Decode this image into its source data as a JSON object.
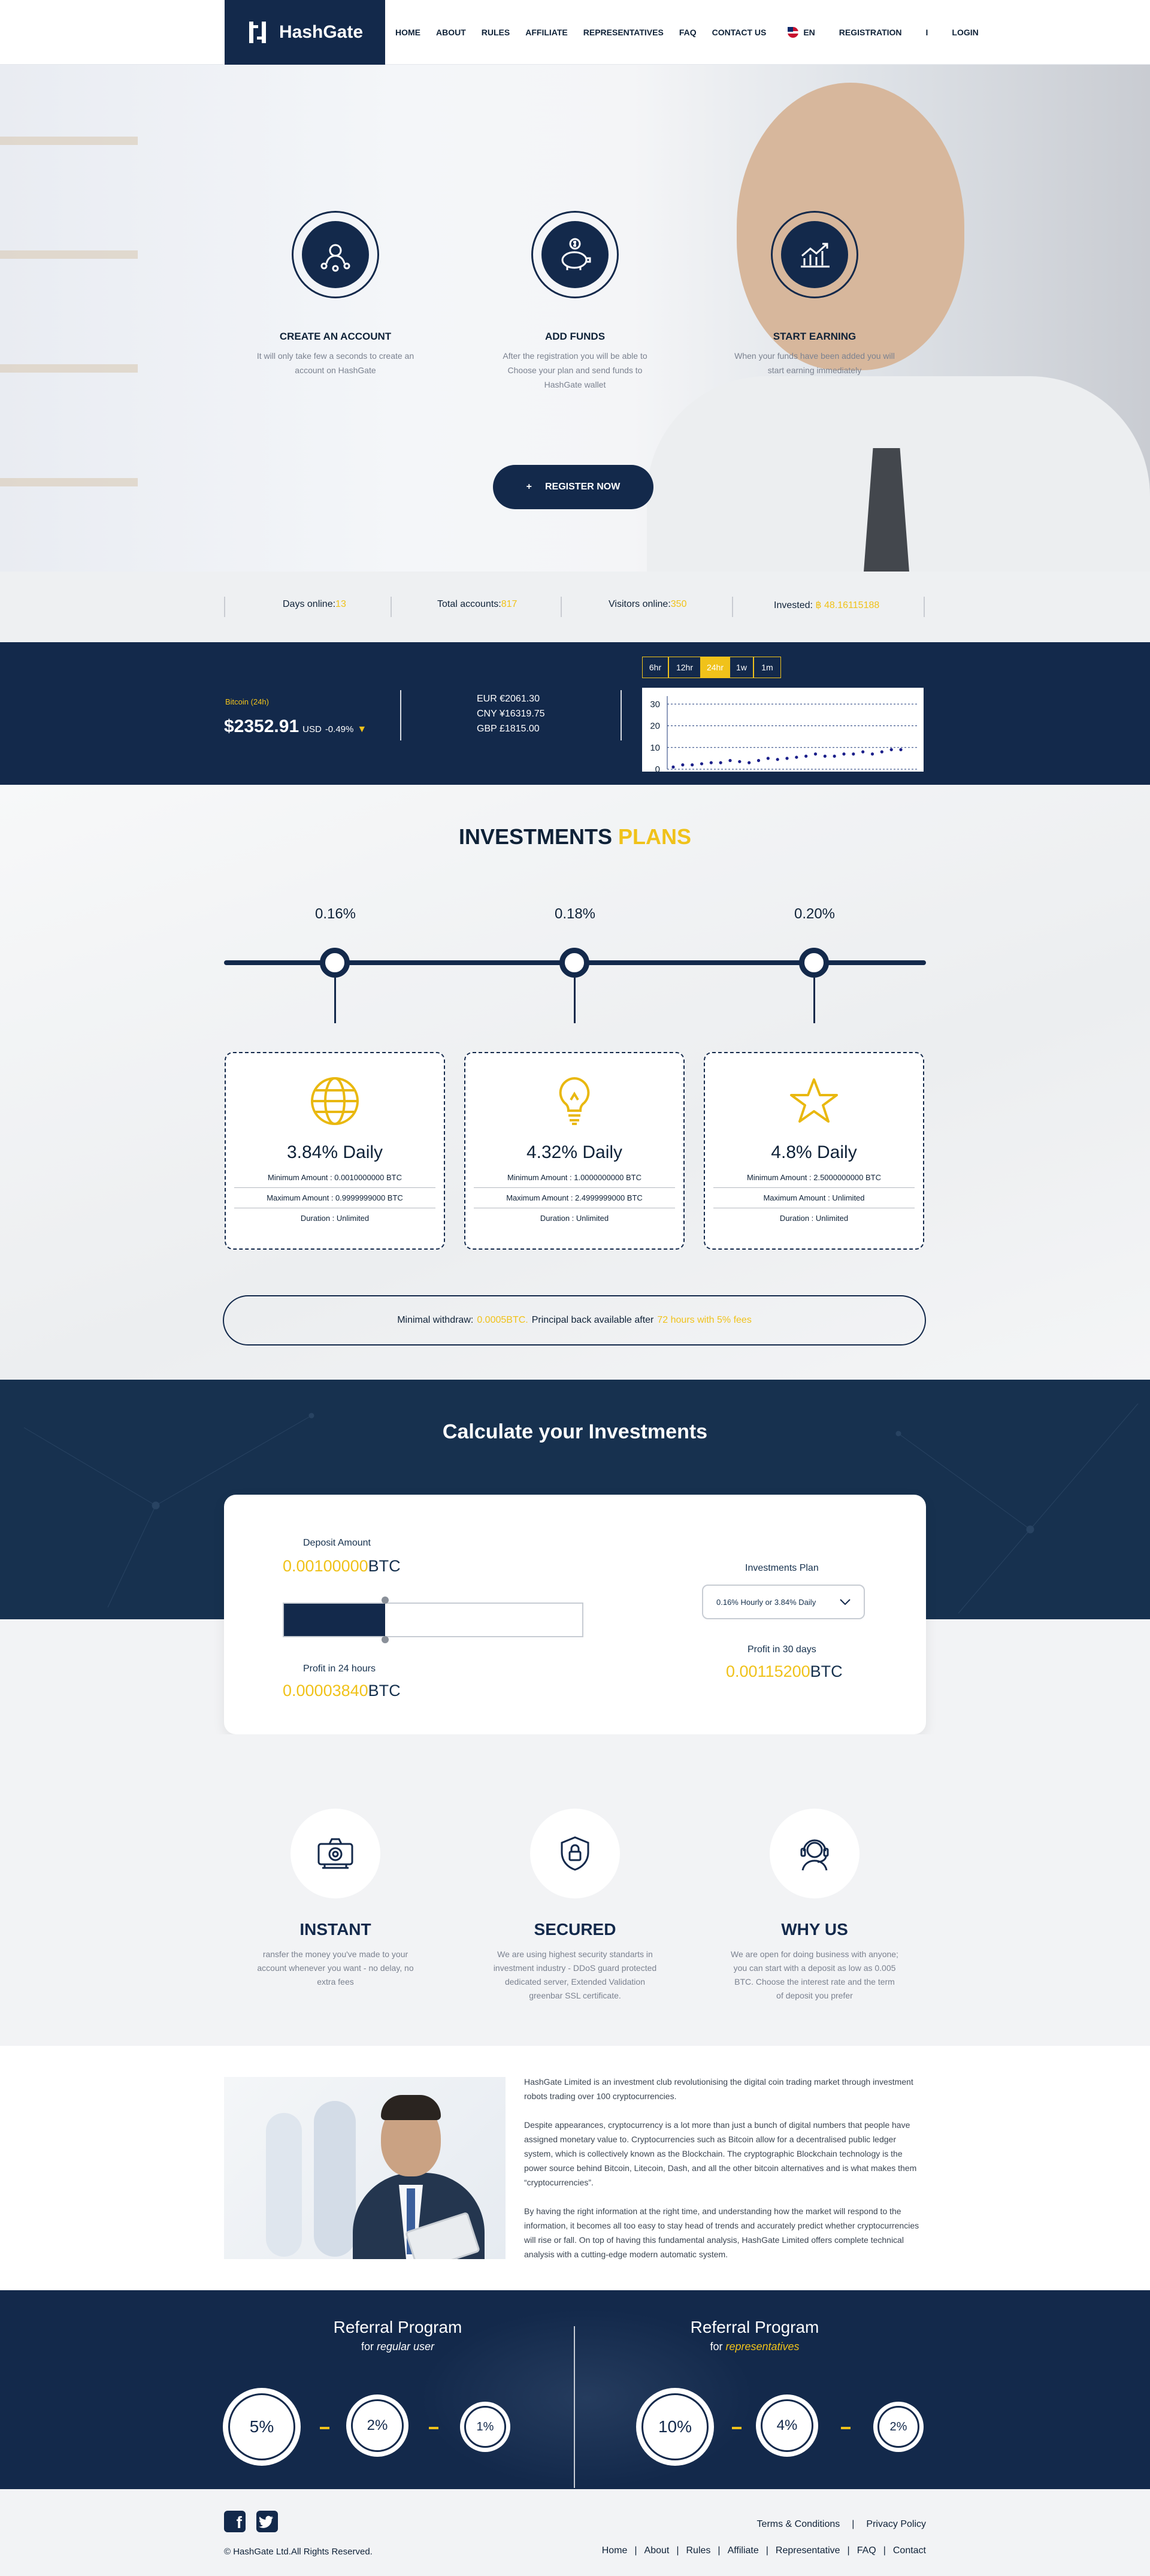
{
  "header": {
    "logo_text": "HashGate",
    "nav": [
      "HOME",
      "ABOUT",
      "RULES",
      "AFFILIATE",
      "REPRESENTATIVES",
      "FAQ",
      "CONTACT US"
    ],
    "language": "EN",
    "registration": "REGISTRATION",
    "separator": "I",
    "login": "LOGIN"
  },
  "hero": {
    "steps": [
      {
        "icon": "user-network-icon",
        "title": "CREATE AN ACCOUNT",
        "text": "It will only take few a seconds to create an account on HashGate"
      },
      {
        "icon": "piggy-bank-icon",
        "title": "ADD FUNDS",
        "text": "After the registration you will be able to Choose your plan and send funds to HashGate wallet"
      },
      {
        "icon": "growth-chart-icon",
        "title": "START EARNING",
        "text": "When your funds have been added you will start earning immediately"
      }
    ],
    "register_plus": "+",
    "register_label": "REGISTER NOW"
  },
  "stats": {
    "days_label": "Days online:",
    "days_value": "13",
    "accounts_label": "Total accounts:",
    "accounts_value": "817",
    "visitors_label": "Visitors online:",
    "visitors_value": "350",
    "invested_label": "Invested:",
    "invested_value": "฿ 48.16115188"
  },
  "bitcoin": {
    "label": "Bitcoin (24h)",
    "price": "$2352.91",
    "currency": "USD",
    "change": "-0.49%",
    "rates": [
      "EUR €2061.30",
      "CNY ¥16319.75",
      "GBP £1815.00"
    ],
    "periods": [
      "6hr",
      "12hr",
      "24hr",
      "1w",
      "1m"
    ],
    "active_period": "24hr",
    "colors": {
      "accent": "#f0c21a",
      "navy": "#13294b"
    }
  },
  "chart_data": {
    "type": "scatter",
    "title": "",
    "xlabel": "",
    "ylabel": "",
    "ylim": [
      0,
      32
    ],
    "yticks": [
      "30",
      "20",
      "10",
      "0"
    ],
    "x": [
      1,
      2,
      3,
      4,
      5,
      6,
      7,
      8,
      9,
      10,
      11,
      12,
      13,
      14,
      15,
      16,
      17,
      18,
      19,
      20,
      21,
      22,
      23,
      24,
      25
    ],
    "values": [
      1,
      2,
      2,
      2.5,
      3,
      3,
      4,
      3.5,
      3,
      4,
      5,
      4.5,
      5,
      5.5,
      6,
      7,
      6,
      6,
      7,
      7,
      8,
      7,
      8,
      9,
      9
    ]
  },
  "plans": {
    "title_main": "INVESTMENTS",
    "title_accent": "PLANS",
    "rates": [
      "0.16%",
      "0.18%",
      "0.20%"
    ],
    "cards": [
      {
        "icon": "globe-icon",
        "daily": "3.84% Daily",
        "min": "Minimum Amount : 0.0010000000 BTC",
        "max": "Maximum Amount : 0.9999999000 BTC",
        "duration": "Duration : Unlimited"
      },
      {
        "icon": "lightbulb-icon",
        "daily": "4.32% Daily",
        "min": "Minimum Amount : 1.0000000000 BTC",
        "max": "Maximum Amount : 2.4999999000 BTC",
        "duration": "Duration : Unlimited"
      },
      {
        "icon": "star-icon",
        "daily": "4.8% Daily",
        "min": "Minimum Amount : 2.5000000000 BTC",
        "max": "Maximum Amount : Unlimited",
        "duration": "Duration : Unlimited"
      }
    ],
    "withdraw_label": "Minimal withdraw:",
    "withdraw_value": "0.0005BTC.",
    "principal_label": "Principal back available after",
    "principal_value": "72 hours with 5% fees"
  },
  "calculator": {
    "title": "Calculate your Investments",
    "deposit_label": "Deposit Amount",
    "deposit_value": "0.00100000",
    "deposit_unit": "BTC",
    "slider_level": 0.34,
    "profit24_label": "Profit in 24 hours",
    "profit24_value": "0.00003840",
    "profit24_unit": "BTC",
    "plan_label": "Investments Plan",
    "plan_selected": "0.16% Hourly or 3.84% Daily",
    "profit30_label": "Profit in 30 days",
    "profit30_value": "0.00115200",
    "profit30_unit": "BTC"
  },
  "features": [
    {
      "icon": "camera-icon",
      "title": "INSTANT",
      "text": "ransfer the money you've made to your account whenever you want - no delay, no extra fees"
    },
    {
      "icon": "shield-lock-icon",
      "title": "SECURED",
      "text": "We are using highest security standarts in investment industry - DDoS guard protected dedicated server, Extended Validation greenbar SSL certificate."
    },
    {
      "icon": "headset-icon",
      "title": "WHY US",
      "text": "We are open for doing business with anyone; you can start with a deposit as low as 0.005 BTC. Choose the interest rate and the term of deposit you prefer"
    }
  ],
  "about": {
    "paragraphs": [
      "HashGate Limited is an investment club revolutionising the digital coin trading market through investment robots trading over 100 cryptocurrencies.",
      "Despite appearances, cryptocurrency is a lot more than just a bunch of digital numbers that people have assigned monetary value to. Cryptocurrencies such as Bitcoin allow for a decentralised public ledger system, which is collectively known as the Blockchain. The cryptographic Blockchain technology is the power source behind Bitcoin, Litecoin, Dash, and all the other bitcoin alternatives and is what makes them “cryptocurrencies”.",
      "By having the right information at the right time, and understanding how the market will respond to the information, it becomes all too easy to stay head of trends and accurately predict whether cryptocurrencies will rise or fall. On top of having this fundamental analysis, HashGate Limited offers complete technical analysis with a cutting-edge modern automatic system."
    ]
  },
  "referral": {
    "regular": {
      "title": "Referral Program",
      "for": "for",
      "audience": "regular user",
      "levels": [
        "5%",
        "2%",
        "1%"
      ]
    },
    "representatives": {
      "title": "Referral Program",
      "for": "for",
      "audience": "representatives",
      "levels": [
        "10%",
        "4%",
        "2%"
      ]
    }
  },
  "footer": {
    "social": [
      "facebook-icon",
      "twitter-icon"
    ],
    "terms": "Terms & Conditions",
    "sep": "|",
    "privacy": "Privacy Policy",
    "copyright": "© HashGate Ltd.All Rights Reserved.",
    "links": [
      "Home",
      "About",
      "Rules",
      "Affiliate",
      "Representative",
      "FAQ",
      "Contact"
    ]
  }
}
